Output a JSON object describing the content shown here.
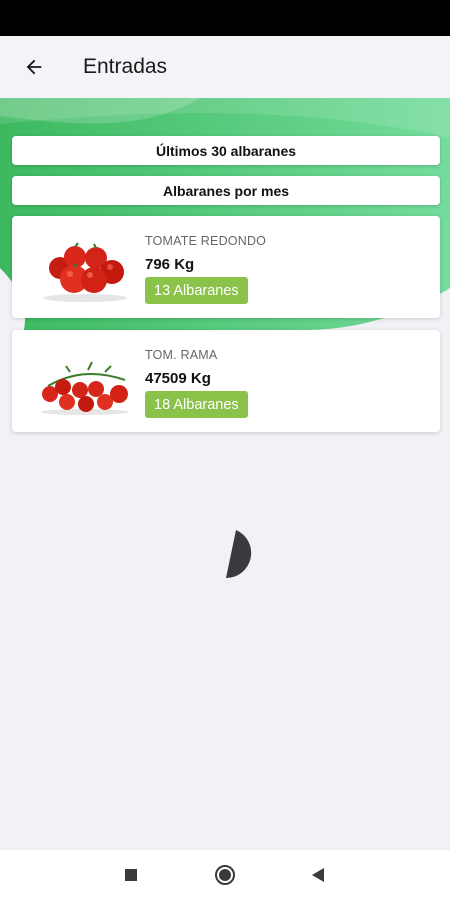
{
  "app_bar": {
    "title": "Entradas",
    "back_icon": "arrow-back-icon"
  },
  "actions": {
    "last30_label": "Últimos 30 albaranes",
    "by_month_label": "Albaranes por mes"
  },
  "products": [
    {
      "name": "TOMATE REDONDO",
      "weight": "796 Kg",
      "badge": "13 Albaranes",
      "image_icon": "round-tomatoes-image"
    },
    {
      "name": "TOM. RAMA",
      "weight": "47509 Kg",
      "badge": "18 Albaranes",
      "image_icon": "vine-tomatoes-image"
    }
  ],
  "loading_indicator": "loading-spinner-icon",
  "nav_bar": {
    "recent_icon": "square-recent-apps-icon",
    "home_icon": "circle-home-icon",
    "back_icon": "triangle-back-icon"
  },
  "colors": {
    "accent_green": "#5fd083",
    "badge_green": "#8bc34a",
    "background": "#f2f1f6"
  }
}
